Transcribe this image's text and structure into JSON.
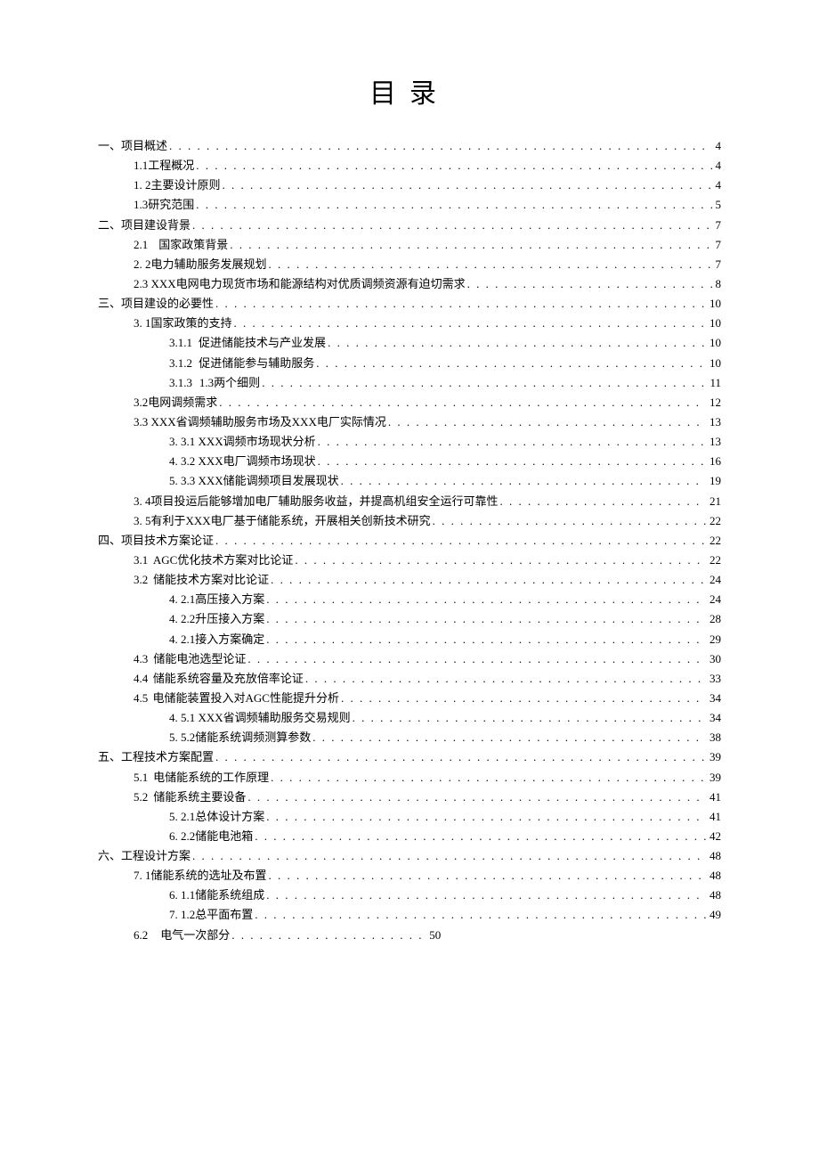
{
  "title": "目录",
  "toc": [
    {
      "level": 0,
      "label": "一、项目概述",
      "page": "4"
    },
    {
      "level": 1,
      "label": "1.1工程概况",
      "page": "4"
    },
    {
      "level": 1,
      "label": "1.  2主要设计原则",
      "page": "4"
    },
    {
      "level": 1,
      "label": "1.3研究范围",
      "page": "5"
    },
    {
      "level": 0,
      "label": "二、项目建设背景",
      "page": "7"
    },
    {
      "level": 1,
      "label": "2.1",
      "gap": 28,
      "label2": "国家政策背景",
      "page": "7"
    },
    {
      "level": 1,
      "label": "2.  2电力辅助服务发展规划",
      "page": "7"
    },
    {
      "level": 1,
      "label": "2.3 XXX电网电力现货市场和能源结构对优质调频资源有迫切需求",
      "page": "8"
    },
    {
      "level": 0,
      "label": "三、项目建设的必要性",
      "page": "10"
    },
    {
      "level": 1,
      "label": "3.  1国家政策的支持",
      "page": "10"
    },
    {
      "level": 2,
      "label": "3.1.1",
      "gap": 18,
      "label2": "促进储能技术与产业发展",
      "page": "10"
    },
    {
      "level": 2,
      "label": "3.1.2",
      "gap": 18,
      "label2": "促进储能参与辅助服务",
      "page": "10"
    },
    {
      "level": 2,
      "label": "3.1.3",
      "gap": 18,
      "label2": "1.3两个细则",
      "page": "11"
    },
    {
      "level": 1,
      "label": "3.2电网调频需求",
      "page": "12"
    },
    {
      "level": 1,
      "label": "3.3 XXX省调频辅助服务市场及XXX电厂实际情况",
      "page": "13"
    },
    {
      "level": 2,
      "label": "3.  3.1 XXX调频市场现状分析",
      "page": "13"
    },
    {
      "level": 2,
      "label": "4.  3.2 XXX电厂调频市场现状",
      "page": "16"
    },
    {
      "level": 2,
      "label": "5.  3.3 XXX储能调频项目发展现状",
      "page": " 19"
    },
    {
      "level": 1,
      "label": "3.  4项目投运后能够增加电厂辅助服务收益，并提高机组安全运行可靠性",
      "page": "21"
    },
    {
      "level": 1,
      "label": "3.  5有利于XXX电厂基于储能系统，开展相关创新技术研究",
      "page": "22"
    },
    {
      "level": 0,
      "label": "四、项目技术方案论证",
      "page": "22"
    },
    {
      "level": 1,
      "label": "3.1",
      "gap": 12,
      "label2": "AGC优化技术方案对比论证",
      "page": "22"
    },
    {
      "level": 1,
      "label": "3.2",
      "gap": 12,
      "label2": "储能技术方案对比论证",
      "page": "24"
    },
    {
      "level": 2,
      "label": "4.  2.1高压接入方案",
      "page": "24"
    },
    {
      "level": 2,
      "label": "4.  2.2升压接入方案",
      "page": "28"
    },
    {
      "level": 2,
      "label": "4.  2.1接入方案确定",
      "page": "29"
    },
    {
      "level": 1,
      "label": "4.3",
      "gap": 12,
      "label2": "储能电池选型论证",
      "page": "30"
    },
    {
      "level": 1,
      "label": "4.4",
      "gap": 12,
      "label2": "储能系统容量及充放倍率论证",
      "page": "33"
    },
    {
      "level": 1,
      "label": "4.5",
      "gap": 12,
      "label2": "电储能装置投入对AGC性能提升分析",
      "page": "34"
    },
    {
      "level": 2,
      "label": "4.  5.1 XXX省调频辅助服务交易规则",
      "page": "34"
    },
    {
      "level": 2,
      "label": "5.  5.2储能系统调频测算参数",
      "page": "38"
    },
    {
      "level": 0,
      "label": "五、工程技术方案配置",
      "page": "39"
    },
    {
      "level": 1,
      "label": "5.1",
      "gap": 12,
      "label2": "电储能系统的工作原理",
      "page": "39"
    },
    {
      "level": 1,
      "label": "5.2",
      "gap": 12,
      "label2": "储能系统主要设备",
      "page": "41"
    },
    {
      "level": 2,
      "label": "5.  2.1总体设计方案",
      "page": "41"
    },
    {
      "level": 2,
      "label": "6.  2.2储能电池箱",
      "page": "42"
    },
    {
      "level": 0,
      "label": "六、工程设计方案",
      "page": "48"
    },
    {
      "level": 1,
      "label": "7.  1储能系统的选址及布置",
      "page": "48"
    },
    {
      "level": 2,
      "label": "6.  1.1储能系统组成",
      "page": "48"
    },
    {
      "level": 2,
      "label": "7.  1.2总平面布置",
      "page": "49"
    },
    {
      "level": 1,
      "label": "6.2",
      "gap": 12,
      "label2": "电气一次部分",
      "page": "50",
      "short": true
    }
  ]
}
